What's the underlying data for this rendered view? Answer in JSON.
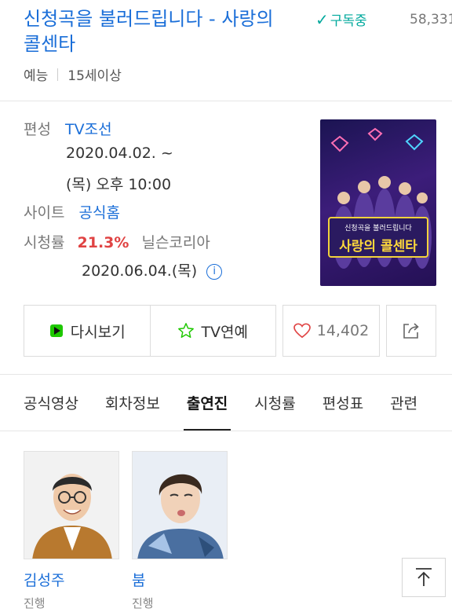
{
  "program": {
    "title_line1": "신청곡을 불러드립니다 - 사랑의",
    "title_line2": "콜센타",
    "subscribe_label": "구독중",
    "subscriber_count": "58,331",
    "genre": "예능",
    "age_rating": "15세이상"
  },
  "details": {
    "channel_label": "편성",
    "channel_value": "TV조선",
    "air_date": "2020.04.02. ~",
    "air_time": "(목) 오후 10:00",
    "site_label": "사이트",
    "site_value": "공식홈",
    "rating_label": "시청률",
    "rating_value": "21.3%",
    "rating_source": "닐슨코리아",
    "rating_date": "2020.06.04.(목)"
  },
  "poster": {
    "small_text": "신청곡을 불러드립니다",
    "large_text": "사랑의 콜센타"
  },
  "actions": {
    "replay_label": "다시보기",
    "tv_news_label": "TV연예",
    "like_count": "14,402"
  },
  "tabs": [
    {
      "label": "공식영상",
      "active": false
    },
    {
      "label": "회차정보",
      "active": false
    },
    {
      "label": "출연진",
      "active": true
    },
    {
      "label": "시청률",
      "active": false
    },
    {
      "label": "편성표",
      "active": false
    },
    {
      "label": "관련",
      "active": false
    }
  ],
  "cast": [
    {
      "name": "김성주",
      "role": "진행"
    },
    {
      "name": "붐",
      "role": "진행"
    }
  ],
  "colors": {
    "link": "#1a6ed8",
    "subscribe": "#00a99d",
    "rating": "#e04343"
  }
}
